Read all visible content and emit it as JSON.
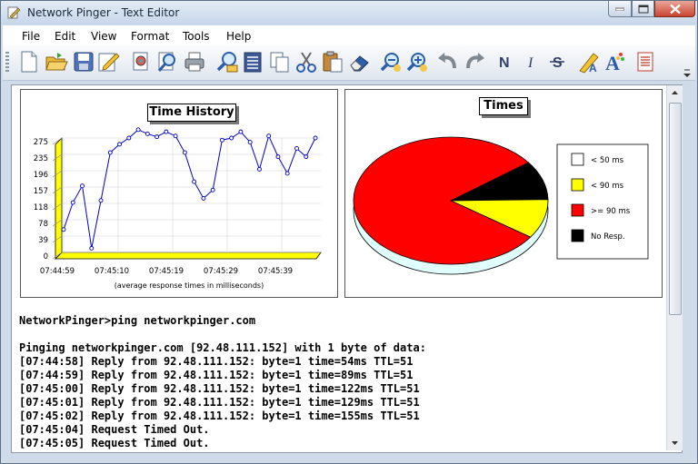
{
  "window": {
    "title": "Network Pinger - Text Editor",
    "app_icon": "notepad-icon"
  },
  "menu": [
    "File",
    "Edit",
    "View",
    "Format",
    "Tools",
    "Help"
  ],
  "toolbar": {
    "buttons": [
      "new-doc-icon",
      "open-folder-icon",
      "save-icon",
      "edit-icon",
      "print-preview-icon",
      "search-icon",
      "print-icon",
      "find-icon",
      "find-next-icon",
      "copy-icon",
      "cut-icon",
      "paste-icon",
      "eraser-icon",
      "zoom-out-icon",
      "zoom-in-icon",
      "undo-icon",
      "redo-icon",
      "normal-text-icon",
      "italic-icon",
      "strikethrough-icon",
      "color-pen-icon",
      "font-icon",
      "page-icon"
    ],
    "bold_label": "N",
    "italic_label": "I",
    "strike_label": "S"
  },
  "time_history": {
    "title": "Time History",
    "caption": "(average response times in milliseconds)",
    "chart_data": {
      "type": "line",
      "title": "Time History",
      "xlabel": "(average response times in milliseconds)",
      "ylabel": "",
      "yticks": [
        "275",
        "235",
        "196",
        "157",
        "118",
        "78",
        "39",
        "0"
      ],
      "xticks": [
        "07:44:59",
        "07:45:10",
        "07:45:19",
        "07:45:29",
        "07:45:39"
      ],
      "ylim": [
        0,
        275
      ],
      "values": [
        55,
        120,
        160,
        10,
        125,
        240,
        260,
        275,
        295,
        285,
        278,
        290,
        280,
        240,
        170,
        130,
        150,
        270,
        275,
        290,
        265,
        200,
        280,
        230,
        190,
        250,
        230,
        275
      ],
      "color": "#0000cc",
      "floor_color": "#ffff00"
    }
  },
  "times": {
    "title": "Times",
    "chart_data": {
      "type": "pie",
      "title": "Times",
      "labels": [
        "< 50 ms",
        "< 90 ms",
        ">= 90 ms",
        "No Resp."
      ],
      "colors": [
        "#ffffff",
        "#ffff00",
        "#ff0000",
        "#000000"
      ],
      "values": [
        0,
        10,
        80,
        10
      ]
    }
  },
  "log_lines": [
    "NetworkPinger>ping networkpinger.com",
    "",
    "Pinging networkpinger.com [92.48.111.152] with 1 byte of data:",
    "[07:44:58] Reply from 92.48.111.152: byte=1 time=54ms TTL=51",
    "[07:44:59] Reply from 92.48.111.152: byte=1 time=89ms TTL=51",
    "[07:45:00] Reply from 92.48.111.152: byte=1 time=122ms TTL=51",
    "[07:45:01] Reply from 92.48.111.152: byte=1 time=129ms TTL=51",
    "[07:45:02] Reply from 92.48.111.152: byte=1 time=155ms TTL=51",
    "[07:45:04] Request Timed Out.",
    "[07:45:05] Request Timed Out."
  ]
}
